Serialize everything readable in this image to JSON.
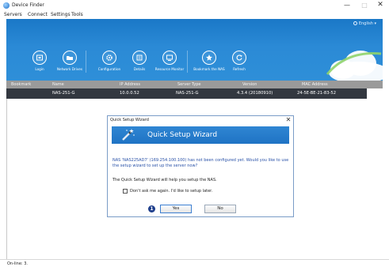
{
  "window": {
    "title": "Device Finder",
    "minimize": "—",
    "maximize": "□",
    "close": "✕"
  },
  "menu": [
    "Servers",
    "Connect",
    "Settings",
    "Tools"
  ],
  "banner": {
    "language": "English",
    "tools": [
      {
        "label": "Login",
        "icon": "login-icon"
      },
      {
        "label": "Network Drives",
        "icon": "folder-icon"
      },
      {
        "label": "Configuration",
        "icon": "gear-icon"
      },
      {
        "label": "Details",
        "icon": "details-icon"
      },
      {
        "label": "Resource Monitor",
        "icon": "monitor-icon"
      },
      {
        "label": "Bookmark the NAS",
        "icon": "star-icon"
      },
      {
        "label": "Refresh",
        "icon": "refresh-icon"
      }
    ]
  },
  "table": {
    "columns": [
      "Bookmark",
      "Name",
      "IP Address",
      "Server Type",
      "Version",
      "MAC Address"
    ],
    "rows": [
      {
        "bookmark": "",
        "name": "NAS-251-G",
        "ip": "10.0.0.52",
        "type": "NAS-251-G",
        "version": "4.3.4 (20180910)",
        "mac": "24-5E-BE-21-83-52"
      }
    ]
  },
  "status": {
    "text": "On-line: 3."
  },
  "dialog": {
    "title": "Quick Setup Wizard",
    "close": "✕",
    "heading": "Quick Setup Wizard",
    "message": "NAS 'NAS225AD7' (169.254.100.100) has not been configured yet. Would you like to use the setup wizard to set up the server now?",
    "info": "The Quick Setup Wizard will help you setup the NAS.",
    "checkbox_label": "Don't ask me again. I'd like to setup later.",
    "badge": "1",
    "yes": "Yes",
    "no": "No"
  },
  "colors": {
    "banner": "#2b8ad6",
    "table_row": "#333840",
    "table_header": "#9a9a9a",
    "dialog_message": "#2a52a8"
  }
}
